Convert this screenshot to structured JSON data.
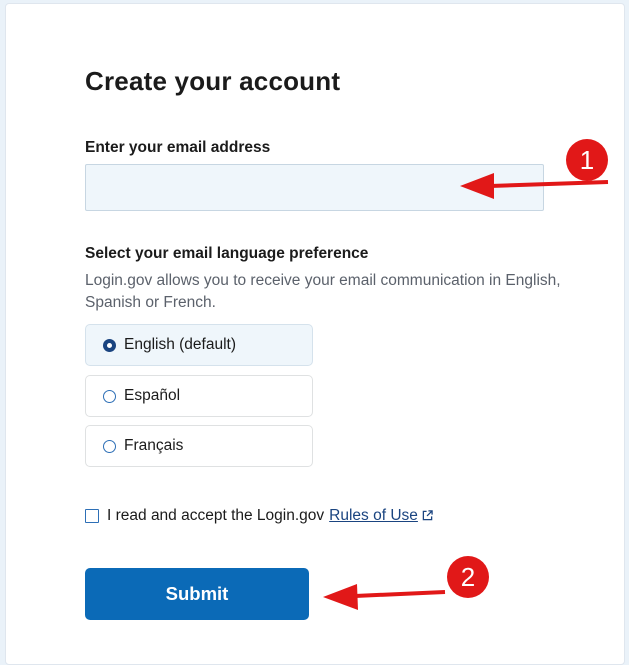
{
  "form": {
    "title": "Create your account",
    "email_label": "Enter your email address",
    "email_value": "",
    "language_label": "Select your email language preference",
    "language_hint": "Login.gov allows you to receive your email communication in English, Spanish or French.",
    "language_options": [
      {
        "label": "English (default)",
        "selected": true
      },
      {
        "label": "Español",
        "selected": false
      },
      {
        "label": "Français",
        "selected": false
      }
    ],
    "terms_text": "I read and accept the Login.gov",
    "terms_link": "Rules of Use",
    "terms_checked": false,
    "submit_label": "Submit"
  },
  "annotations": {
    "badge_1": "1",
    "badge_2": "2",
    "color": "#e11818"
  },
  "colors": {
    "primary": "#0b6ab7",
    "link": "#1a4480",
    "input_bg": "#eff6fb"
  }
}
